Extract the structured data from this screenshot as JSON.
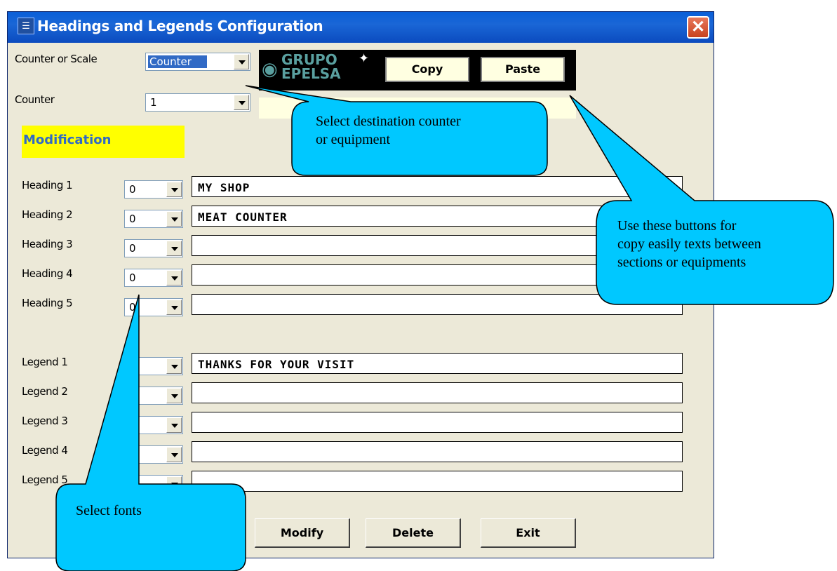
{
  "window": {
    "title": "Headings and Legends Configuration"
  },
  "top": {
    "counter_or_scale_label": "Counter or Scale",
    "counter_or_scale_value": "Counter",
    "counter_label": "Counter",
    "counter_value": "1",
    "modification_label": "Modification",
    "logo_line1": "GRUPO",
    "logo_line2": "EPELSA",
    "copy_label": "Copy",
    "paste_label": "Paste"
  },
  "headings": [
    {
      "label": "Heading 1",
      "font": "0",
      "text": "MY SHOP"
    },
    {
      "label": "Heading 2",
      "font": "0",
      "text": "MEAT COUNTER"
    },
    {
      "label": "Heading 3",
      "font": "0",
      "text": ""
    },
    {
      "label": "Heading 4",
      "font": "0",
      "text": ""
    },
    {
      "label": "Heading 5",
      "font": "0",
      "text": ""
    }
  ],
  "legends": [
    {
      "label": "Legend 1",
      "font": "",
      "text": "THANKS FOR YOUR VISIT"
    },
    {
      "label": "Legend 2",
      "font": "",
      "text": ""
    },
    {
      "label": "Legend 3",
      "font": "",
      "text": ""
    },
    {
      "label": "Legend 4",
      "font": "",
      "text": ""
    },
    {
      "label": "Legend 5",
      "font": "",
      "text": ""
    }
  ],
  "buttons": {
    "modify": "Modify",
    "delete": "Delete",
    "exit": "Exit"
  },
  "callouts": {
    "destination": [
      "Select destination counter",
      "or equipment"
    ],
    "copy_paste": [
      "Use these buttons   for",
      "copy easily texts between",
      "sections or equipments"
    ],
    "fonts": "Select fonts"
  },
  "colors": {
    "callout_fill": "#00c8ff",
    "highlight": "#ffff00",
    "modification_text": "#316ac5"
  }
}
